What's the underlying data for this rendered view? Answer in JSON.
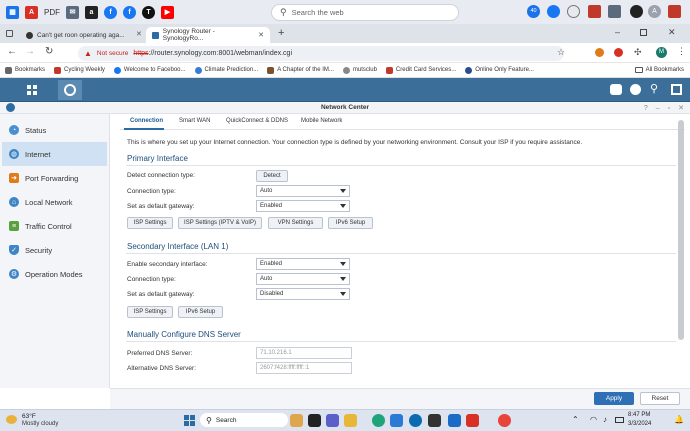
{
  "top_bar": {
    "pdf_label": "PDF",
    "search_placeholder": "Search the web",
    "notification_count": "40",
    "avatar_letter": "A"
  },
  "tabs": [
    {
      "label": "Can't get roon operating aga..."
    },
    {
      "label": "Synology Router - SynologyRo..."
    }
  ],
  "address": {
    "security_label": "Not secure",
    "url_scheme": "https",
    "url_rest": "://router.synology.com:8001/webman/index.cgi",
    "profile_letter": "M"
  },
  "bookmarks": {
    "items": [
      {
        "label": "Bookmarks",
        "color": "#666666"
      },
      {
        "label": "Cycling Weekly",
        "color": "#c0392b"
      },
      {
        "label": "Welcome to Faceboo...",
        "color": "#1877f2"
      },
      {
        "label": "Climate Prediction...",
        "color": "#3a7bd5"
      },
      {
        "label": "A Chapter of the IM...",
        "color": "#7a5230"
      },
      {
        "label": "mutsclub",
        "color": "#888888"
      },
      {
        "label": "Credit Card Services...",
        "color": "#c0392b"
      },
      {
        "label": "Online Only Feature...",
        "color": "#2a4d8f"
      }
    ],
    "all_label": "All Bookmarks"
  },
  "window": {
    "title": "Network Center"
  },
  "sidebar": {
    "items": [
      {
        "label": "Status",
        "icon": "gauge-icon",
        "color": "#4a8fd0"
      },
      {
        "label": "Internet",
        "icon": "globe-icon",
        "color": "#3d85c6"
      },
      {
        "label": "Port Forwarding",
        "icon": "forward-arrow-icon",
        "color": "#e07b1a"
      },
      {
        "label": "Local Network",
        "icon": "network-icon",
        "color": "#3d85c6"
      },
      {
        "label": "Traffic Control",
        "icon": "traffic-icon",
        "color": "#5aa03c"
      },
      {
        "label": "Security",
        "icon": "shield-icon",
        "color": "#3d85c6"
      },
      {
        "label": "Operation Modes",
        "icon": "modes-icon",
        "color": "#3d85c6"
      }
    ],
    "active_index": 1
  },
  "main": {
    "tabs": [
      "Connection",
      "Smart WAN",
      "QuickConnect & DDNS",
      "Mobile Network"
    ],
    "intro": "This is where you set up your Internet connection. Your connection type is defined by your networking environment. Consult your ISP if you require assistance.",
    "primary": {
      "title": "Primary Interface",
      "detect_label": "Detect connection type:",
      "detect_button": "Detect",
      "conn_type_label": "Connection type:",
      "conn_type_value": "Auto",
      "gateway_label": "Set as default gateway:",
      "gateway_value": "Enabled",
      "buttons": [
        "ISP Settings",
        "ISP Settings (IPTV & VoIP)",
        "VPN Settings",
        "IPv6 Setup"
      ]
    },
    "secondary": {
      "title": "Secondary Interface (LAN 1)",
      "enable_label": "Enable secondary interface:",
      "enable_value": "Enabled",
      "conn_type_label": "Connection type:",
      "conn_type_value": "Auto",
      "gateway_label": "Set as default gateway:",
      "gateway_value": "Disabled",
      "buttons": [
        "ISP Settings",
        "IPv6 Setup"
      ]
    },
    "dns": {
      "title": "Manually Configure DNS Server",
      "preferred_label": "Preferred DNS Server:",
      "preferred_value": "71.10.216.1",
      "alternative_label": "Alternative DNS Server:",
      "alternative_value": "2607:f428:ffff:ffff::1"
    }
  },
  "footer": {
    "apply": "Apply",
    "reset": "Reset"
  },
  "taskbar": {
    "weather_temp": "63°F",
    "weather_desc": "Mostly cloudy",
    "search_label": "Search",
    "time": "8:47 PM",
    "date": "3/3/2024"
  },
  "colors": {
    "accent": "#2f6fb5",
    "dsm_header": "#3b6f99",
    "not_secure": "#c5221f"
  }
}
